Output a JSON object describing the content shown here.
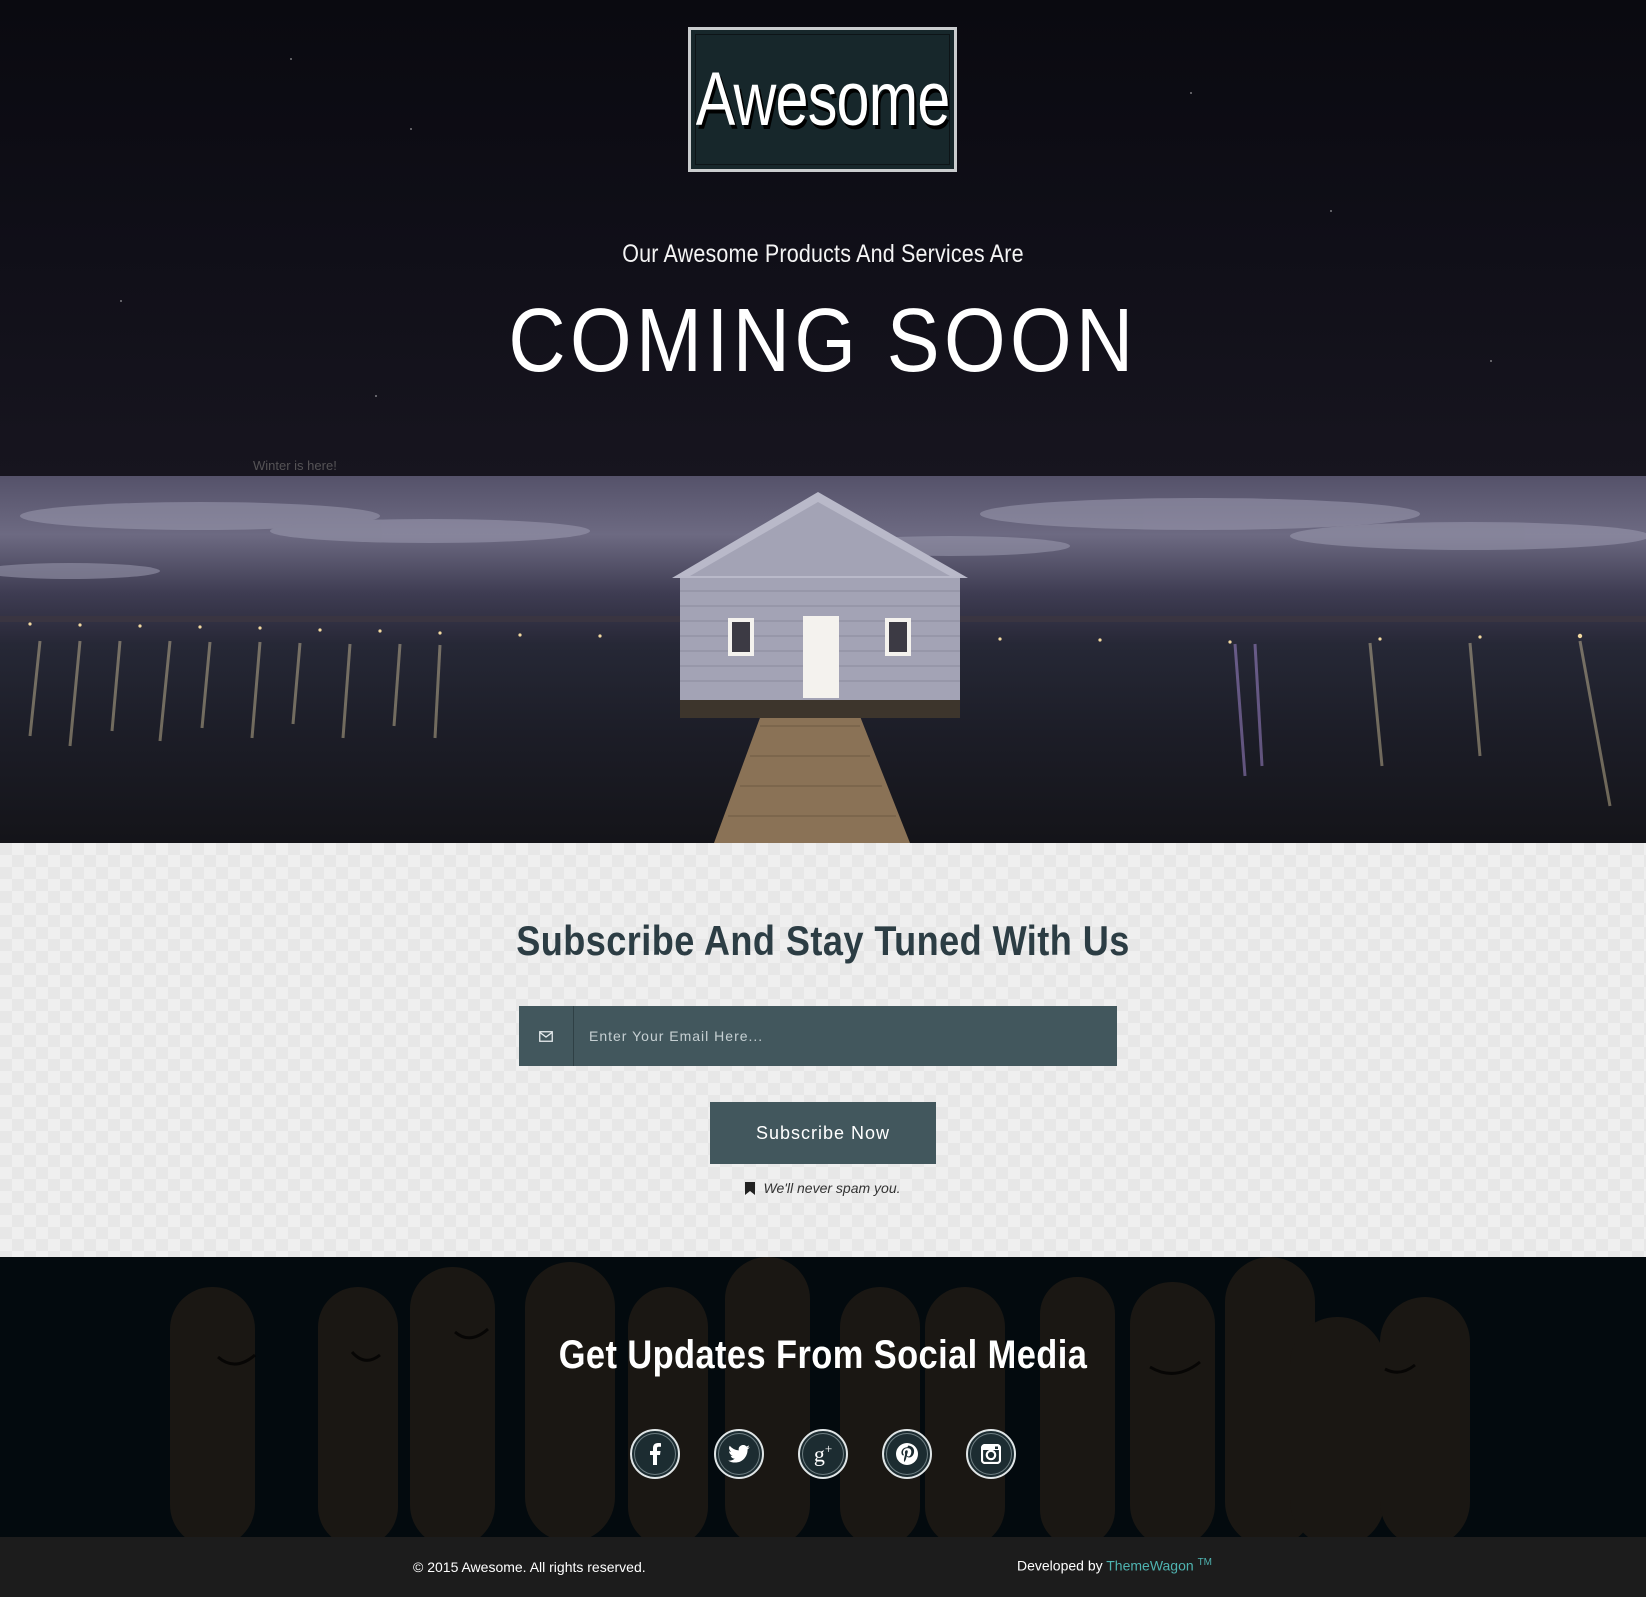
{
  "hero": {
    "logo_text": "Awesome",
    "tagline": "Our Awesome Products And Services Are",
    "headline": "COMING SOON",
    "image_label": "Winter is here!"
  },
  "subscribe": {
    "title": "Subscribe And Stay Tuned With Us",
    "email_placeholder": "Enter Your Email Here...",
    "button_label": "Subscribe Now",
    "no_spam_text": "We'll never spam you."
  },
  "social": {
    "title": "Get Updates From Social Media",
    "icons": [
      "facebook-icon",
      "twitter-icon",
      "google-plus-icon",
      "pinterest-icon",
      "instagram-icon"
    ]
  },
  "footer": {
    "copyright": "© 2015 Awesome. All rights reserved.",
    "developed_prefix": "Developed by ",
    "developer_name": "ThemeWagon",
    "trademark": "TM"
  },
  "colors": {
    "accent": "#42575d",
    "link": "#4fb3b0",
    "logo_bg": "#17272b"
  }
}
